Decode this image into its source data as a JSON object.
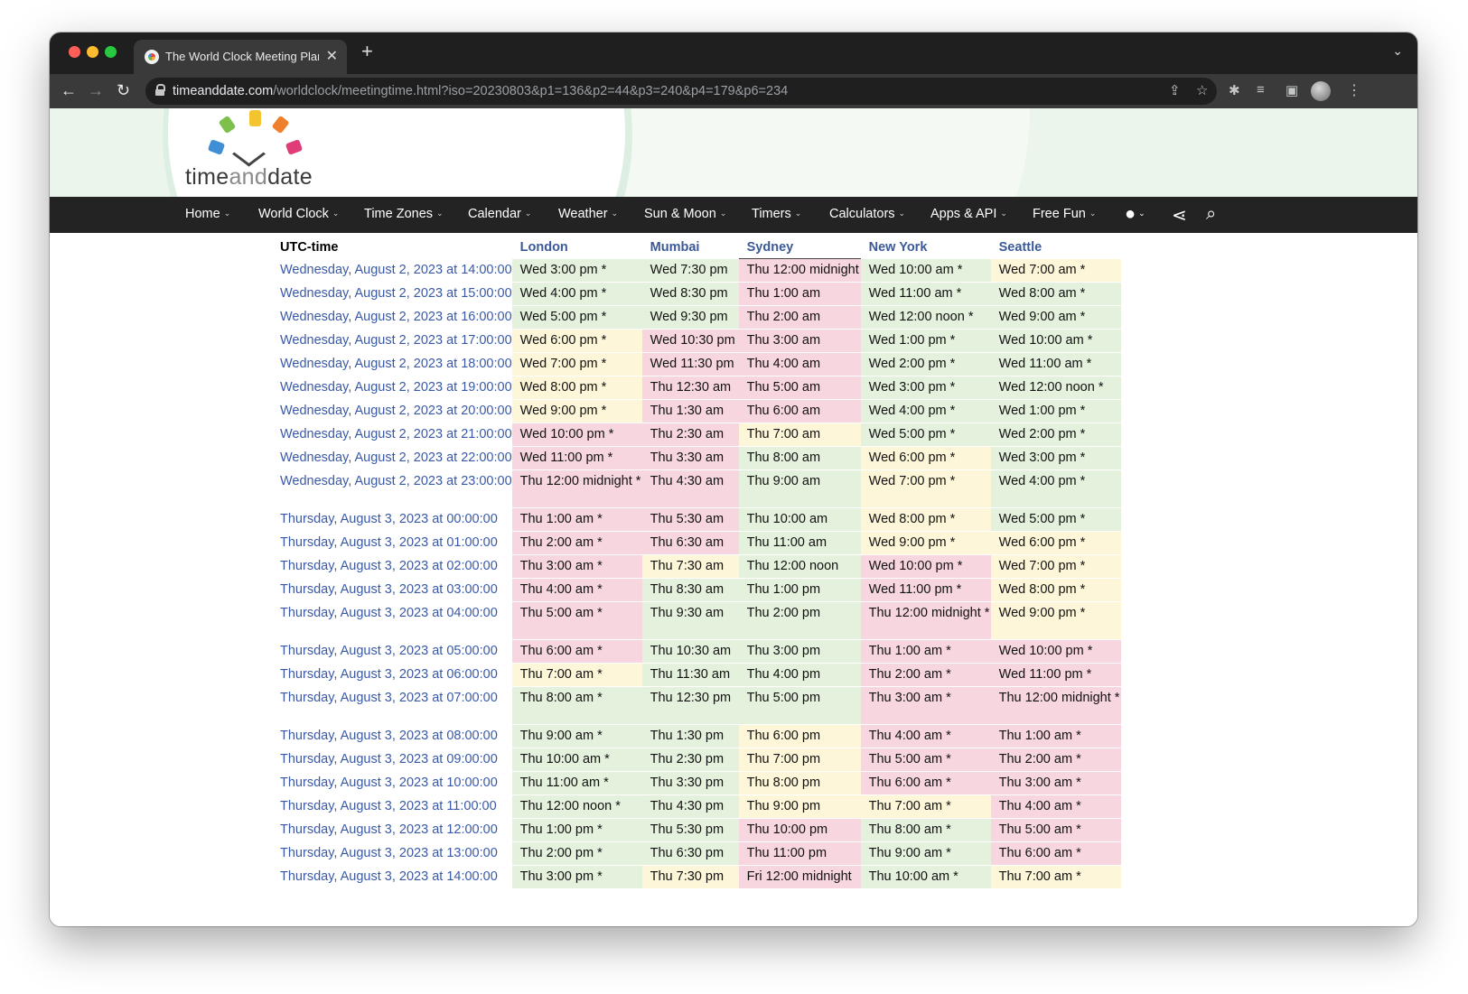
{
  "browser": {
    "tab_title": "The World Clock Meeting Planner",
    "url_host": "timeanddate.com",
    "url_path": "/worldclock/meetingtime.html?iso=20230803&p1=136&p2=44&p3=240&p4=179&p6=234",
    "new_tab": "+",
    "tab_close": "✕",
    "tab_list": "⌄"
  },
  "logo": {
    "pre": "time",
    "mid": "and",
    "post": "date"
  },
  "nav": {
    "items": [
      "Home",
      "World Clock",
      "Time Zones",
      "Calendar",
      "Weather",
      "Sun & Moon",
      "Timers",
      "Calculators",
      "Apps & API",
      "Free Fun"
    ]
  },
  "table": {
    "headers": [
      "UTC-time",
      "London",
      "Mumbai",
      "Sydney",
      "New York",
      "Seattle"
    ],
    "rows": [
      {
        "utc": "Wednesday, August 2, 2023 at 14:00:00",
        "cells": [
          "Wed 3:00 pm *",
          "Wed 7:30 pm",
          "Thu 12:00 midnight",
          "Wed 10:00 am *",
          "Wed 7:00 am *"
        ]
      },
      {
        "utc": "Wednesday, August 2, 2023 at 15:00:00",
        "cells": [
          "Wed 4:00 pm *",
          "Wed 8:30 pm",
          "Thu 1:00 am",
          "Wed 11:00 am *",
          "Wed 8:00 am *"
        ]
      },
      {
        "utc": "Wednesday, August 2, 2023 at 16:00:00",
        "cells": [
          "Wed 5:00 pm *",
          "Wed 9:30 pm",
          "Thu 2:00 am",
          "Wed 12:00 noon *",
          "Wed 9:00 am *"
        ]
      },
      {
        "utc": "Wednesday, August 2, 2023 at 17:00:00",
        "cells": [
          "Wed 6:00 pm *",
          "Wed 10:30 pm",
          "Thu 3:00 am",
          "Wed 1:00 pm *",
          "Wed 10:00 am *"
        ]
      },
      {
        "utc": "Wednesday, August 2, 2023 at 18:00:00",
        "cells": [
          "Wed 7:00 pm *",
          "Wed 11:30 pm",
          "Thu 4:00 am",
          "Wed 2:00 pm *",
          "Wed 11:00 am *"
        ]
      },
      {
        "utc": "Wednesday, August 2, 2023 at 19:00:00",
        "cells": [
          "Wed 8:00 pm *",
          "Thu 12:30 am",
          "Thu 5:00 am",
          "Wed 3:00 pm *",
          "Wed 12:00 noon *"
        ]
      },
      {
        "utc": "Wednesday, August 2, 2023 at 20:00:00",
        "cells": [
          "Wed 9:00 pm *",
          "Thu 1:30 am",
          "Thu 6:00 am",
          "Wed 4:00 pm *",
          "Wed 1:00 pm *"
        ]
      },
      {
        "utc": "Wednesday, August 2, 2023 at 21:00:00",
        "cells": [
          "Wed 10:00 pm *",
          "Thu 2:30 am",
          "Thu 7:00 am",
          "Wed 5:00 pm *",
          "Wed 2:00 pm *"
        ]
      },
      {
        "utc": "Wednesday, August 2, 2023 at 22:00:00",
        "cells": [
          "Wed 11:00 pm *",
          "Thu 3:30 am",
          "Thu 8:00 am",
          "Wed 6:00 pm *",
          "Wed 3:00 pm *"
        ]
      },
      {
        "utc": "Wednesday, August 2, 2023 at 23:00:00",
        "cells": [
          "Thu 12:00 midnight *",
          "Thu 4:30 am",
          "Thu 9:00 am",
          "Wed 7:00 pm *",
          "Wed 4:00 pm *"
        ]
      },
      {
        "utc": "Thursday, August 3, 2023 at 00:00:00",
        "cells": [
          "Thu 1:00 am *",
          "Thu 5:30 am",
          "Thu 10:00 am",
          "Wed 8:00 pm *",
          "Wed 5:00 pm *"
        ]
      },
      {
        "utc": "Thursday, August 3, 2023 at 01:00:00",
        "cells": [
          "Thu 2:00 am *",
          "Thu 6:30 am",
          "Thu 11:00 am",
          "Wed 9:00 pm *",
          "Wed 6:00 pm *"
        ]
      },
      {
        "utc": "Thursday, August 3, 2023 at 02:00:00",
        "cells": [
          "Thu 3:00 am *",
          "Thu 7:30 am",
          "Thu 12:00 noon",
          "Wed 10:00 pm *",
          "Wed 7:00 pm *"
        ]
      },
      {
        "utc": "Thursday, August 3, 2023 at 03:00:00",
        "cells": [
          "Thu 4:00 am *",
          "Thu 8:30 am",
          "Thu 1:00 pm",
          "Wed 11:00 pm *",
          "Wed 8:00 pm *"
        ]
      },
      {
        "utc": "Thursday, August 3, 2023 at 04:00:00",
        "cells": [
          "Thu 5:00 am *",
          "Thu 9:30 am",
          "Thu 2:00 pm",
          "Thu 12:00 midnight *",
          "Wed 9:00 pm *"
        ]
      },
      {
        "utc": "Thursday, August 3, 2023 at 05:00:00",
        "cells": [
          "Thu 6:00 am *",
          "Thu 10:30 am",
          "Thu 3:00 pm",
          "Thu 1:00 am *",
          "Wed 10:00 pm *"
        ]
      },
      {
        "utc": "Thursday, August 3, 2023 at 06:00:00",
        "cells": [
          "Thu 7:00 am *",
          "Thu 11:30 am",
          "Thu 4:00 pm",
          "Thu 2:00 am *",
          "Wed 11:00 pm *"
        ]
      },
      {
        "utc": "Thursday, August 3, 2023 at 07:00:00",
        "cells": [
          "Thu 8:00 am *",
          "Thu 12:30 pm",
          "Thu 5:00 pm",
          "Thu 3:00 am *",
          "Thu 12:00 midnight *"
        ]
      },
      {
        "utc": "Thursday, August 3, 2023 at 08:00:00",
        "cells": [
          "Thu 9:00 am *",
          "Thu 1:30 pm",
          "Thu 6:00 pm",
          "Thu 4:00 am *",
          "Thu 1:00 am *"
        ]
      },
      {
        "utc": "Thursday, August 3, 2023 at 09:00:00",
        "cells": [
          "Thu 10:00 am *",
          "Thu 2:30 pm",
          "Thu 7:00 pm",
          "Thu 5:00 am *",
          "Thu 2:00 am *"
        ]
      },
      {
        "utc": "Thursday, August 3, 2023 at 10:00:00",
        "cells": [
          "Thu 11:00 am *",
          "Thu 3:30 pm",
          "Thu 8:00 pm",
          "Thu 6:00 am *",
          "Thu 3:00 am *"
        ]
      },
      {
        "utc": "Thursday, August 3, 2023 at 11:00:00",
        "cells": [
          "Thu 12:00 noon *",
          "Thu 4:30 pm",
          "Thu 9:00 pm",
          "Thu 7:00 am *",
          "Thu 4:00 am *"
        ]
      },
      {
        "utc": "Thursday, August 3, 2023 at 12:00:00",
        "cells": [
          "Thu 1:00 pm *",
          "Thu 5:30 pm",
          "Thu 10:00 pm",
          "Thu 8:00 am *",
          "Thu 5:00 am *"
        ]
      },
      {
        "utc": "Thursday, August 3, 2023 at 13:00:00",
        "cells": [
          "Thu 2:00 pm *",
          "Thu 6:30 pm",
          "Thu 11:00 pm",
          "Thu 9:00 am *",
          "Thu 6:00 am *"
        ]
      },
      {
        "utc": "Thursday, August 3, 2023 at 14:00:00",
        "cells": [
          "Thu 3:00 pm *",
          "Thu 7:30 pm",
          "Fri 12:00 midnight",
          "Thu 10:00 am *",
          "Thu 7:00 am *"
        ]
      }
    ]
  },
  "colors": {
    "business": "#e4f1dd",
    "evening": "#fdf6d8",
    "night": "#f7d6e0",
    "link": "#3959a8"
  }
}
